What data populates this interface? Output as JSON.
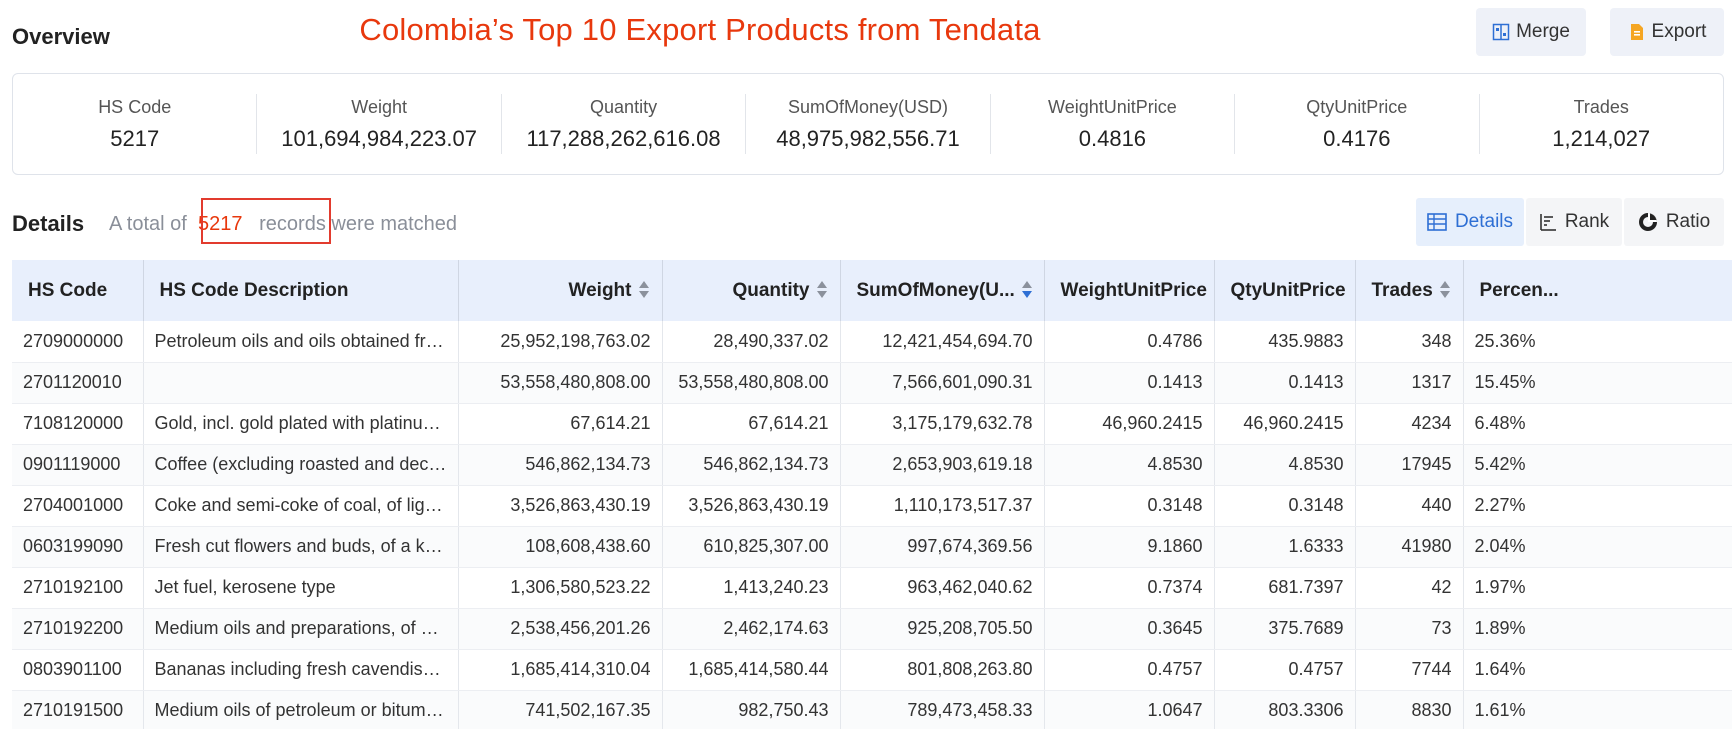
{
  "header": {
    "overview_title": "Overview",
    "banner_title": "Colombia’s Top 10 Export Products from Tendata",
    "merge_label": "Merge",
    "export_label": "Export"
  },
  "summary": [
    {
      "label": "HS Code",
      "value": "5217"
    },
    {
      "label": "Weight",
      "value": "101,694,984,223.07"
    },
    {
      "label": "Quantity",
      "value": "117,288,262,616.08"
    },
    {
      "label": "SumOfMoney(USD)",
      "value": "48,975,982,556.71"
    },
    {
      "label": "WeightUnitPrice",
      "value": "0.4816"
    },
    {
      "label": "QtyUnitPrice",
      "value": "0.4176"
    },
    {
      "label": "Trades",
      "value": "1,214,027"
    }
  ],
  "details": {
    "title": "Details",
    "sub_prefix": "A total of",
    "count": "5217",
    "sub_mid": "records",
    "sub_suffix": "were matched",
    "views": {
      "details": "Details",
      "rank": "Rank",
      "ratio": "Ratio"
    }
  },
  "table": {
    "columns": [
      "HS Code",
      "HS Code Description",
      "Weight",
      "Quantity",
      "SumOfMoney(U...",
      "WeightUnitPrice",
      "QtyUnitPrice",
      "Trades",
      "Percen..."
    ],
    "rows": [
      [
        "2709000000",
        "Petroleum oils and oils obtained from ...",
        "25,952,198,763.02",
        "28,490,337.02",
        "12,421,454,694.70",
        "0.4786",
        "435.9883",
        "348",
        "25.36%"
      ],
      [
        "2701120010",
        "",
        "53,558,480,808.00",
        "53,558,480,808.00",
        "7,566,601,090.31",
        "0.1413",
        "0.1413",
        "1317",
        "15.45%"
      ],
      [
        "7108120000",
        "Gold, incl. gold plated with platinum, u...",
        "67,614.21",
        "67,614.21",
        "3,175,179,632.78",
        "46,960.2415",
        "46,960.2415",
        "4234",
        "6.48%"
      ],
      [
        "0901119000",
        "Coffee (excluding roasted and decaffei...",
        "546,862,134.73",
        "546,862,134.73",
        "2,653,903,619.18",
        "4.8530",
        "4.8530",
        "17945",
        "5.42%"
      ],
      [
        "2704001000",
        "Coke and semi-coke of coal, of lignite ...",
        "3,526,863,430.19",
        "3,526,863,430.19",
        "1,110,173,517.37",
        "0.3148",
        "0.3148",
        "440",
        "2.27%"
      ],
      [
        "0603199090",
        "Fresh cut flowers and buds, of a kind s...",
        "108,608,438.60",
        "610,825,307.00",
        "997,674,369.56",
        "9.1860",
        "1.6333",
        "41980",
        "2.04%"
      ],
      [
        "2710192100",
        "Jet fuel, kerosene type",
        "1,306,580,523.22",
        "1,413,240.23",
        "963,462,040.62",
        "0.7374",
        "681.7397",
        "42",
        "1.97%"
      ],
      [
        "2710192200",
        "Medium oils and preparations, of petro...",
        "2,538,456,201.26",
        "2,462,174.63",
        "925,208,705.50",
        "0.3645",
        "375.7689",
        "73",
        "1.89%"
      ],
      [
        "0803901100",
        "Bananas including fresh cavendish val...",
        "1,685,414,310.04",
        "1,685,414,580.44",
        "801,808,263.80",
        "0.4757",
        "0.4757",
        "7744",
        "1.64%"
      ],
      [
        "2710191500",
        "Medium oils of petroleum or bituminou...",
        "741,502,167.35",
        "982,750.43",
        "789,473,458.33",
        "1.0647",
        "803.3306",
        "8830",
        "1.61%"
      ]
    ]
  },
  "colors": {
    "accent": "#2e6fd4",
    "banner": "#e8380d",
    "highlight_box": "#e23b2e",
    "header_bg": "#e8effc"
  }
}
